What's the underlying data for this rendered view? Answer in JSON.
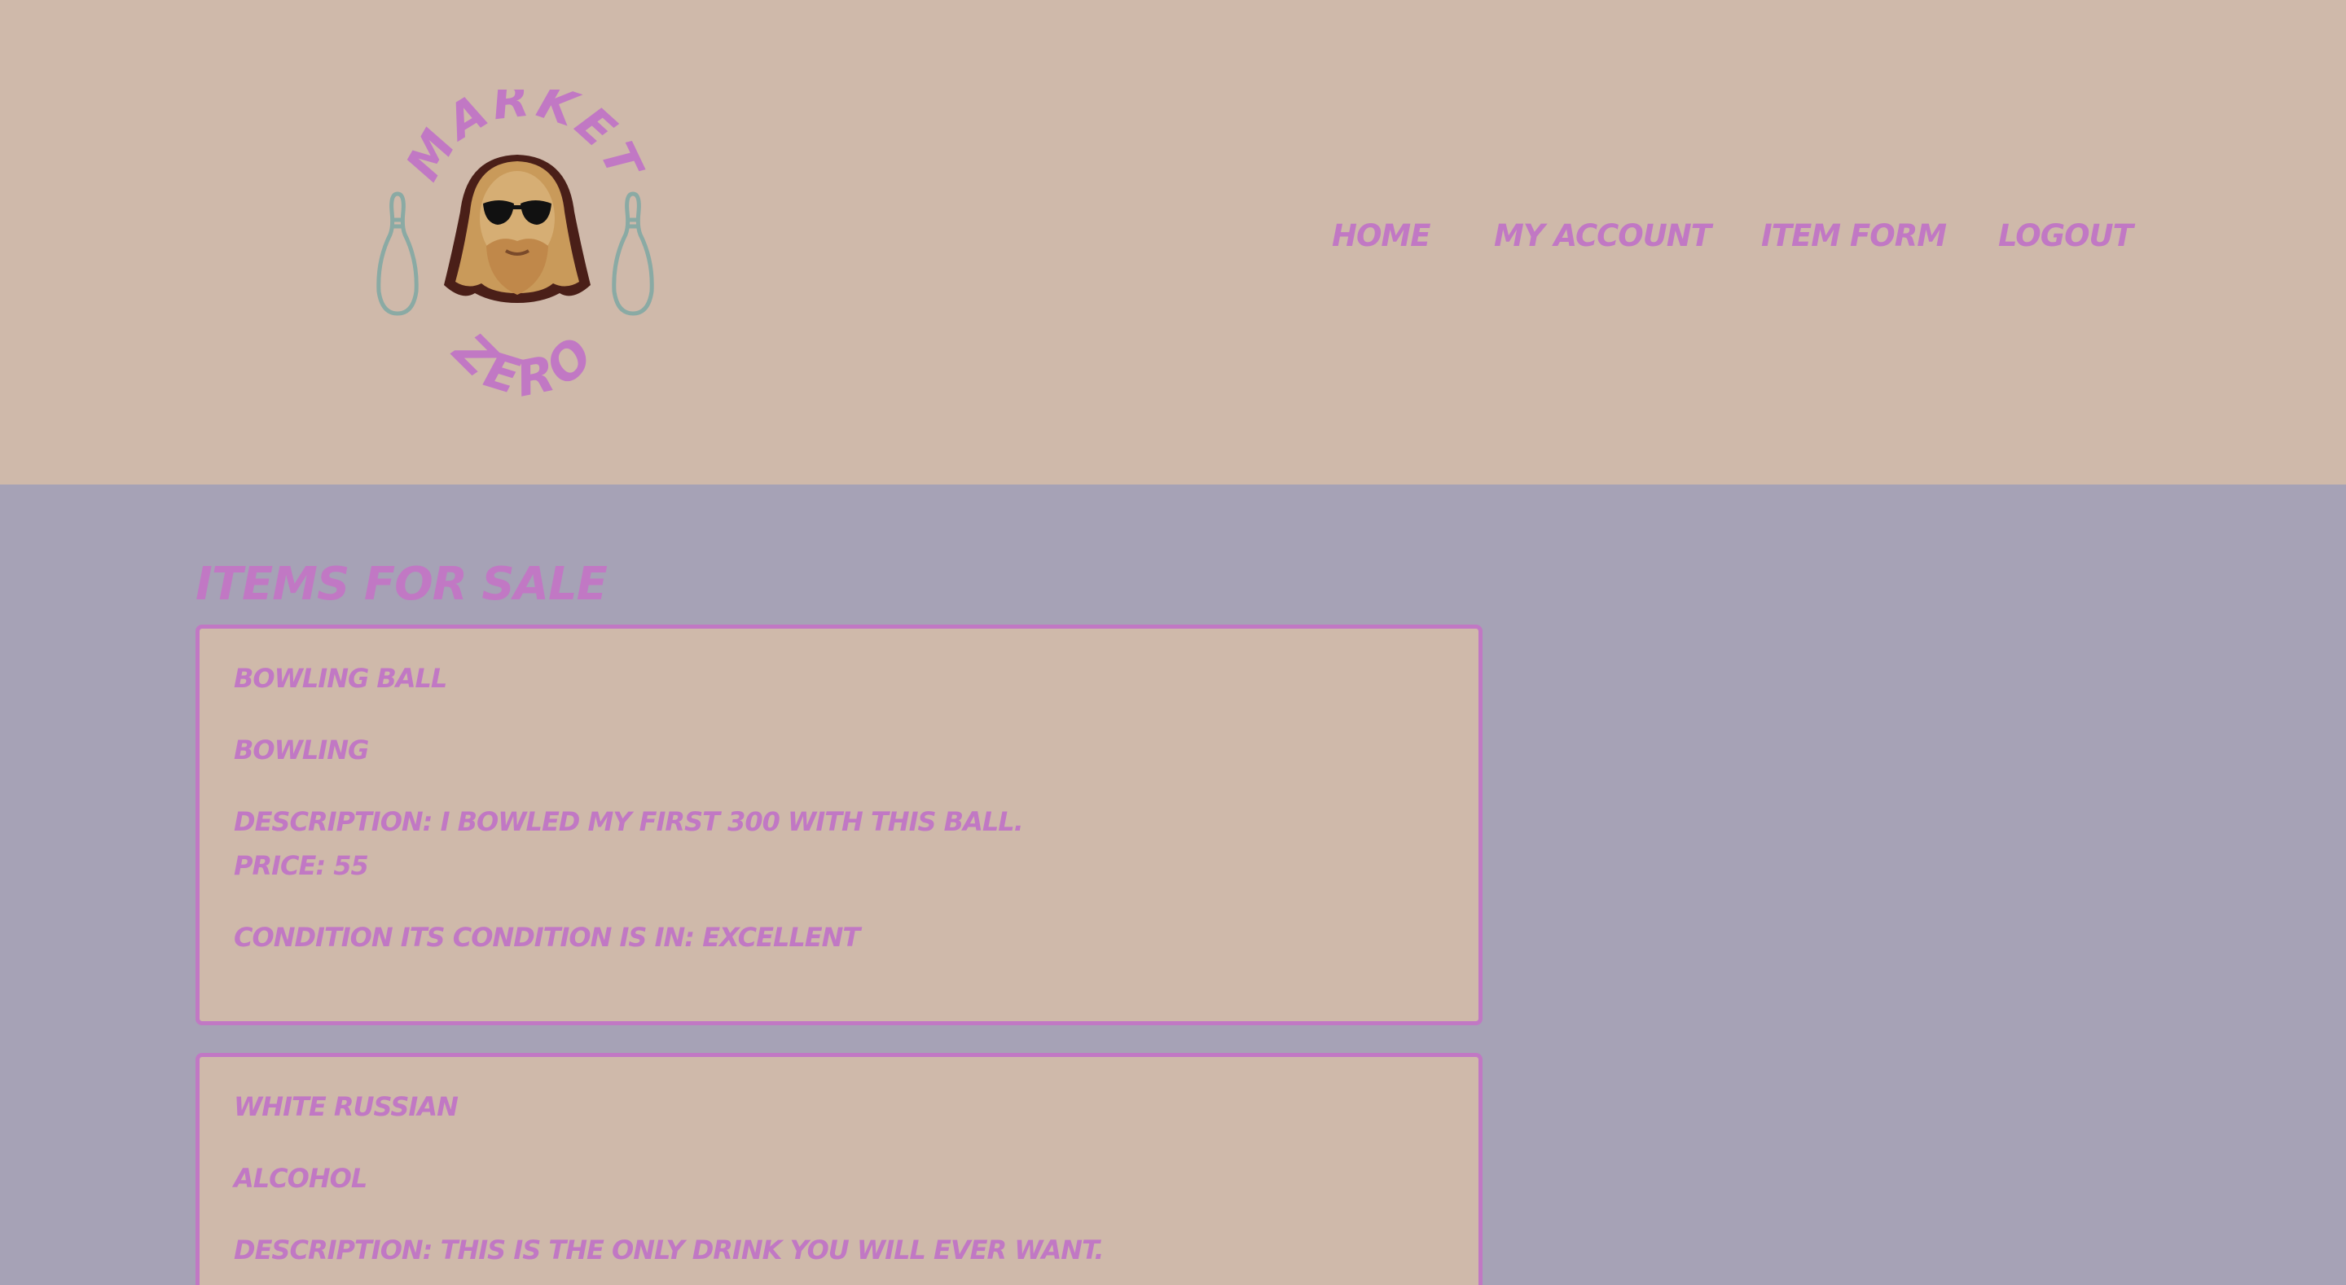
{
  "brand": {
    "logo_text_top": "MARKET",
    "logo_text_bottom": "ZERO"
  },
  "nav": {
    "items": [
      {
        "label": "HOME"
      },
      {
        "label": "MY ACCOUNT"
      },
      {
        "label": "ITEM FORM"
      },
      {
        "label": "LOGOUT"
      }
    ]
  },
  "main": {
    "title": "ITEMS FOR SALE",
    "items": [
      {
        "name": "BOWLING BALL",
        "category": "BOWLING",
        "description": "DESCRIPTION: I BOWLED MY FIRST 300 WITH THIS BALL.",
        "price": "PRICE: 55",
        "condition": "CONDITION ITS CONDITION IS IN: EXCELLENT"
      },
      {
        "name": "WHITE RUSSIAN",
        "category": "ALCOHOL",
        "description": "DESCRIPTION: THIS IS THE ONLY DRINK YOU WILL EVER WANT."
      }
    ]
  },
  "colors": {
    "header_bg": "#cfb9aa",
    "page_bg": "#a6a2b6",
    "accent": "#c178c4",
    "pin": "#8aaaa4"
  }
}
